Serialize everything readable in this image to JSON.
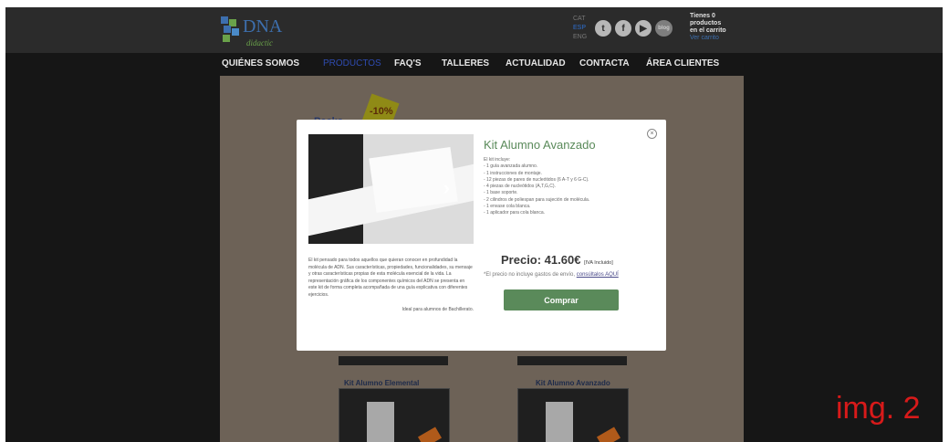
{
  "header": {
    "logo_text": "DNA",
    "logo_sub": "didactic",
    "languages": [
      "CAT",
      "ESP",
      "ENG"
    ],
    "social": [
      "t",
      "f",
      "yt",
      "blog"
    ],
    "cart_title": "Tienes 0",
    "cart_line2": "productos",
    "cart_line3": "en el carrito",
    "cart_link": "Ver carrito"
  },
  "nav": {
    "items": [
      {
        "label": "QUIÉNES SOMOS"
      },
      {
        "label": "PRODUCTOS"
      },
      {
        "label": "FAQ'S"
      },
      {
        "label": "TALLERES"
      },
      {
        "label": "ACTUALIDAD"
      },
      {
        "label": "CONTACTA"
      },
      {
        "label": "ÁREA CLIENTES"
      }
    ],
    "active": "PRODUCTOS"
  },
  "background": {
    "section_title": "Packs",
    "discount_badge": "-10%",
    "products": [
      {
        "name": "Kit Alumno Elemental"
      },
      {
        "name": "Kit Alumno Avanzado"
      }
    ]
  },
  "modal": {
    "title": "Kit Alumno Avanzado",
    "includes_heading": "El kit incluye:",
    "includes": [
      "- 1 guía avanzada alumno.",
      "- 1 instrucciones de montaje.",
      "- 12 piezas de pares de nucleótidos (6 A-T y 6 G-C).",
      "- 4 piezas de nucleótidos (A,T,G,C).",
      "- 1 base soporte.",
      "- 2 cilindros de poliespan para sujeción de molécula.",
      "- 1 envase cola blanca.",
      "- 1 aplicador para cola blanca."
    ],
    "description": "El kit pensado para todos aquellos que quieran conocer en profundidad la molécula de ADN. Sus características, propiedades, funcionalidades, su mensaje y otras características propias de esta molécula esencial de la vida. La representación gráfica de los componentes químicos del ADN se presenta en este kit de forma completa acompañada de una guía explicativa con diferentes ejercicios.",
    "ideal_for": "Ideal para alumnos de Bachillerato.",
    "price_label": "Precio: 41.60€",
    "price_note": "[IVA Incluido]",
    "shipping_text": "*El precio no incluye gastos de envío,",
    "shipping_link": "consúltalos AQUÍ",
    "buy_label": "Comprar",
    "close_icon": "×"
  },
  "annotation": {
    "label": "img. 2"
  }
}
